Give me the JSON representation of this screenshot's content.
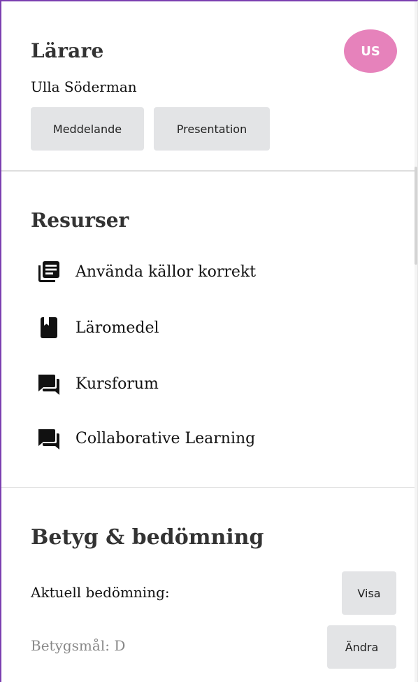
{
  "teacher": {
    "heading": "Lärare",
    "name": "Ulla Söderman",
    "avatar_initials": "US",
    "avatar_color": "#e682bb",
    "message_button": "Meddelande",
    "presentation_button": "Presentation"
  },
  "resources": {
    "heading": "Resurser",
    "items": [
      {
        "label": "Använda källor korrekt",
        "icon": "article-icon"
      },
      {
        "label": "Läromedel",
        "icon": "book-icon"
      },
      {
        "label": "Kursforum",
        "icon": "forum-icon"
      },
      {
        "label": "Collaborative Learning",
        "icon": "forum-icon"
      }
    ]
  },
  "grades": {
    "heading": "Betyg & bedömning",
    "current_label": "Aktuell bedömning:",
    "show_button": "Visa",
    "goal_label": "Betygsmål: D",
    "change_button": "Ändra"
  },
  "colors": {
    "accent_border": "#7b3fb0",
    "button_bg": "#e3e4e6"
  }
}
